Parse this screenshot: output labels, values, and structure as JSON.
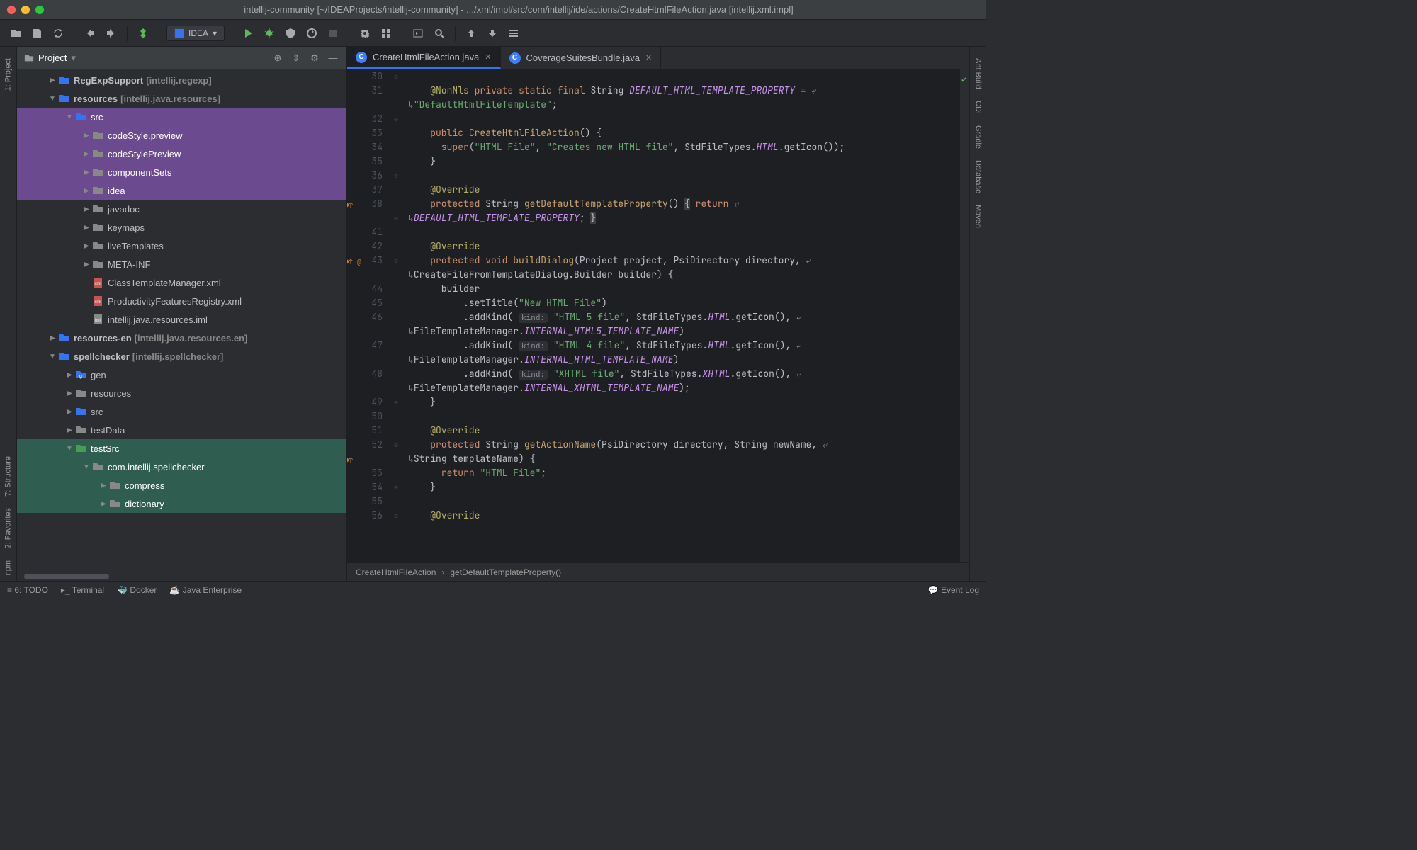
{
  "title": "intellij-community [~/IDEAProjects/intellij-community] - .../xml/impl/src/com/intellij/ide/actions/CreateHtmlFileAction.java [intellij.xml.impl]",
  "runConfig": "IDEA",
  "projectPanel": {
    "title": "Project"
  },
  "leftStripe": [
    "1: Project",
    "7: Structure",
    "2: Favorites",
    "npm"
  ],
  "rightStripe": [
    "Ant Build",
    "CDI",
    "Gradle",
    "Database",
    "Maven"
  ],
  "tree": [
    {
      "indent": 42,
      "arrow": "▶",
      "icon": "folder-mod",
      "label": "RegExpSupport",
      "module": "[intellij.regexp]",
      "bold": true
    },
    {
      "indent": 42,
      "arrow": "▼",
      "icon": "folder-mod",
      "label": "resources",
      "module": "[intellij.java.resources]",
      "bold": true
    },
    {
      "indent": 66,
      "arrow": "▼",
      "icon": "folder-src",
      "label": "src",
      "sel": "purple"
    },
    {
      "indent": 90,
      "arrow": "▶",
      "icon": "folder",
      "label": "codeStyle.preview",
      "sel": "purple"
    },
    {
      "indent": 90,
      "arrow": "▶",
      "icon": "folder",
      "label": "codeStylePreview",
      "sel": "purple"
    },
    {
      "indent": 90,
      "arrow": "▶",
      "icon": "folder",
      "label": "componentSets",
      "sel": "purple"
    },
    {
      "indent": 90,
      "arrow": "▶",
      "icon": "folder",
      "label": "idea",
      "sel": "purple"
    },
    {
      "indent": 90,
      "arrow": "▶",
      "icon": "folder",
      "label": "javadoc"
    },
    {
      "indent": 90,
      "arrow": "▶",
      "icon": "folder",
      "label": "keymaps"
    },
    {
      "indent": 90,
      "arrow": "▶",
      "icon": "folder",
      "label": "liveTemplates"
    },
    {
      "indent": 90,
      "arrow": "▶",
      "icon": "folder",
      "label": "META-INF"
    },
    {
      "indent": 90,
      "arrow": "",
      "icon": "xml",
      "label": "ClassTemplateManager.xml"
    },
    {
      "indent": 90,
      "arrow": "",
      "icon": "xml",
      "label": "ProductivityFeaturesRegistry.xml"
    },
    {
      "indent": 90,
      "arrow": "",
      "icon": "iml",
      "label": "intellij.java.resources.iml"
    },
    {
      "indent": 42,
      "arrow": "▶",
      "icon": "folder-mod",
      "label": "resources-en",
      "module": "[intellij.java.resources.en]",
      "bold": true
    },
    {
      "indent": 42,
      "arrow": "▼",
      "icon": "folder-mod",
      "label": "spellchecker",
      "module": "[intellij.spellchecker]",
      "bold": true
    },
    {
      "indent": 66,
      "arrow": "▶",
      "icon": "folder-gen",
      "label": "gen"
    },
    {
      "indent": 66,
      "arrow": "▶",
      "icon": "folder",
      "label": "resources"
    },
    {
      "indent": 66,
      "arrow": "▶",
      "icon": "folder-src",
      "label": "src"
    },
    {
      "indent": 66,
      "arrow": "▶",
      "icon": "folder",
      "label": "testData"
    },
    {
      "indent": 66,
      "arrow": "▼",
      "icon": "folder-test",
      "label": "testSrc",
      "sel": "teal"
    },
    {
      "indent": 90,
      "arrow": "▼",
      "icon": "folder",
      "label": "com.intellij.spellchecker",
      "sel": "teal"
    },
    {
      "indent": 114,
      "arrow": "▶",
      "icon": "folder",
      "label": "compress",
      "sel": "teal"
    },
    {
      "indent": 114,
      "arrow": "▶",
      "icon": "folder",
      "label": "dictionary",
      "sel": "teal"
    }
  ],
  "tabs": [
    {
      "label": "CreateHtmlFileAction.java",
      "active": true
    },
    {
      "label": "CoverageSuitesBundle.java",
      "active": false
    }
  ],
  "gutter": [
    "30",
    "31",
    "",
    "32",
    "33",
    "34",
    "35",
    "36",
    "37",
    "38",
    "",
    "41",
    "42",
    "43",
    "",
    "44",
    "45",
    "46",
    "",
    "47",
    "",
    "48",
    "",
    "49",
    "50",
    "51",
    "52",
    "",
    "53",
    "54",
    "55",
    "56"
  ],
  "gutterMarks": {
    "9": "●↑",
    "13": "●↑ @",
    "27": "●↑"
  },
  "fold": {
    "0": "⊖",
    "3": "⊖",
    "7": "⊖",
    "10": "⊖",
    "13": "⊖",
    "23": "⊖",
    "26": "⊖",
    "29": "⊖",
    "31": "⊖"
  },
  "code": {
    "l31a": [
      "@NonNls",
      " ",
      "private",
      " ",
      "static",
      " ",
      "final",
      " String ",
      "DEFAULT_HTML_TEMPLATE_PROPERTY",
      " = "
    ],
    "l31b": "\"DefaultHtmlFileTemplate\"",
    "l33": [
      "public",
      " ",
      "CreateHtmlFileAction",
      "() {"
    ],
    "l34": [
      "super",
      "(",
      "\"HTML File\"",
      ", ",
      "\"Creates new HTML file\"",
      ", StdFileTypes.",
      "HTML",
      ".getIcon());"
    ],
    "l37": "@Override",
    "l38a": [
      "protected",
      " String ",
      "getDefaultTemplateProperty",
      "() { ",
      "return",
      " "
    ],
    "l38b": "DEFAULT_HTML_TEMPLATE_PROPERTY",
    "l42": "@Override",
    "l43a": [
      "protected",
      " ",
      "void",
      " ",
      "buildDialog",
      "(Project project, PsiDirectory directory, "
    ],
    "l43b": "CreateFileFromTemplateDialog.Builder builder) {",
    "l44": "builder",
    "l45": [
      ".setTitle(",
      "\"New HTML File\"",
      ")"
    ],
    "l46": [
      ".addKind( ",
      "kind:",
      " ",
      "\"HTML 5 file\"",
      ", StdFileTypes.",
      "HTML",
      ".getIcon(), "
    ],
    "l46b": [
      "FileTemplateManager.",
      "INTERNAL_HTML5_TEMPLATE_NAME",
      ")"
    ],
    "l47": [
      ".addKind( ",
      "kind:",
      " ",
      "\"HTML 4 file\"",
      ", StdFileTypes.",
      "HTML",
      ".getIcon(), "
    ],
    "l47b": [
      "FileTemplateManager.",
      "INTERNAL_HTML_TEMPLATE_NAME",
      ")"
    ],
    "l48": [
      ".addKind( ",
      "kind:",
      " ",
      "\"XHTML file\"",
      ", StdFileTypes.",
      "XHTML",
      ".getIcon(), "
    ],
    "l48b": [
      "FileTemplateManager.",
      "INTERNAL_XHTML_TEMPLATE_NAME",
      ");"
    ],
    "l51": "@Override",
    "l52a": [
      "protected",
      " String ",
      "getActionName",
      "(PsiDirectory directory, String newName, "
    ],
    "l52b": "String templateName) {",
    "l53": [
      "return",
      " ",
      "\"HTML File\"",
      ";"
    ],
    "l56": "@Override"
  },
  "breadcrumb": [
    "CreateHtmlFileAction",
    "getDefaultTemplateProperty()"
  ],
  "statusbar": {
    "todo": "6: TODO",
    "terminal": "Terminal",
    "docker": "Docker",
    "enterprise": "Java Enterprise",
    "eventlog": "Event Log"
  }
}
